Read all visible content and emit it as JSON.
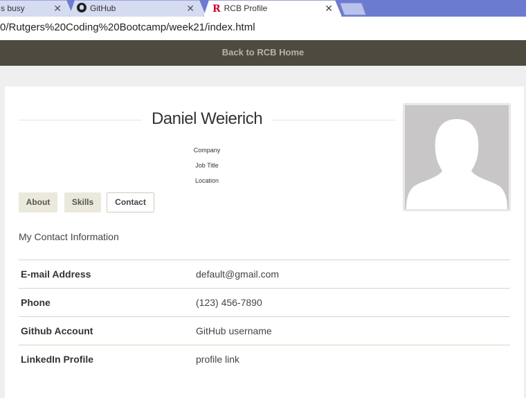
{
  "browser": {
    "tabs": [
      {
        "title": "s busy",
        "close": "✕"
      },
      {
        "title": "GitHub",
        "close": "✕"
      },
      {
        "title": "RCB Profile",
        "close": "✕"
      }
    ],
    "url": "0/Rutgers%20Coding%20Bootcamp/week21/index.html"
  },
  "navbar": {
    "home_link": "Back to RCB Home"
  },
  "profile": {
    "name": "Daniel Weierich",
    "company": "Company",
    "job_title": "Job Title",
    "location": "Location"
  },
  "tabs": [
    {
      "label": "About"
    },
    {
      "label": "Skills"
    },
    {
      "label": "Contact"
    }
  ],
  "contact": {
    "title": "My Contact Information",
    "rows": [
      {
        "label": "E-mail Address",
        "value": "default@gmail.com"
      },
      {
        "label": "Phone",
        "value": "(123) 456-7890"
      },
      {
        "label": "Github Account",
        "value": "GitHub username"
      },
      {
        "label": "LinkedIn Profile",
        "value": "profile link"
      }
    ]
  },
  "colors": {
    "navbar": "#4e4a40",
    "tab_inactive": "#ebe9dc",
    "tabstrip": "#6c7bd0",
    "rutgers_red": "#cc0033"
  }
}
